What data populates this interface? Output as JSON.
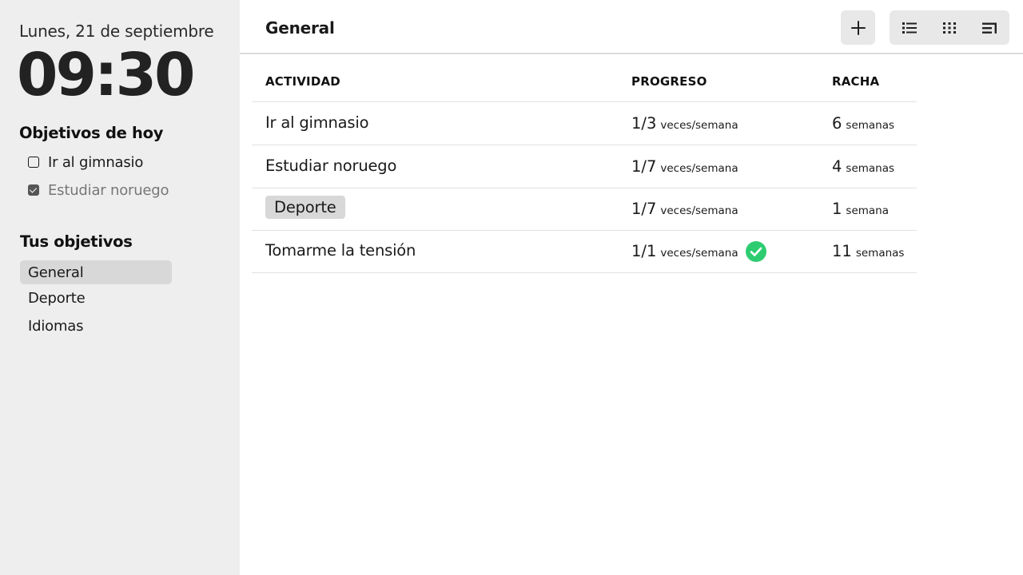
{
  "sidebar": {
    "date": "Lunes, 21 de septiembre",
    "time": "09:30",
    "today_title": "Objetivos de hoy",
    "today_items": [
      {
        "label": "Ir al gimnasio",
        "checked": false
      },
      {
        "label": "Estudiar noruego",
        "checked": true
      }
    ],
    "goals_title": "Tus objetivos",
    "goals": [
      {
        "label": "General",
        "active": true
      },
      {
        "label": "Deporte",
        "active": false
      },
      {
        "label": "Idiomas",
        "active": false
      }
    ]
  },
  "header": {
    "title": "General",
    "add_icon": "plus-icon",
    "view_icons": [
      "list-view-icon",
      "grid-view-icon",
      "compact-view-icon"
    ]
  },
  "table": {
    "columns": [
      "ACTIVIDAD",
      "PROGRESO",
      "RACHA"
    ],
    "rows": [
      {
        "activity": "Ir al gimnasio",
        "tag": false,
        "progress": "1/3",
        "progress_unit": "veces/semana",
        "completed": false,
        "streak": "6",
        "streak_unit": "semanas"
      },
      {
        "activity": "Estudiar noruego",
        "tag": false,
        "progress": "1/7",
        "progress_unit": "veces/semana",
        "completed": false,
        "streak": "4",
        "streak_unit": "semanas"
      },
      {
        "activity": "Deporte",
        "tag": true,
        "progress": "1/7",
        "progress_unit": "veces/semana",
        "completed": false,
        "streak": "1",
        "streak_unit": "semana"
      },
      {
        "activity": "Tomarme la tensión",
        "tag": false,
        "progress": "1/1",
        "progress_unit": "veces/semana",
        "completed": true,
        "streak": "11",
        "streak_unit": "semanas"
      }
    ]
  },
  "colors": {
    "sidebar_bg": "#eeeeee",
    "active_bg": "#d8d8d8",
    "success": "#2ecc71"
  }
}
